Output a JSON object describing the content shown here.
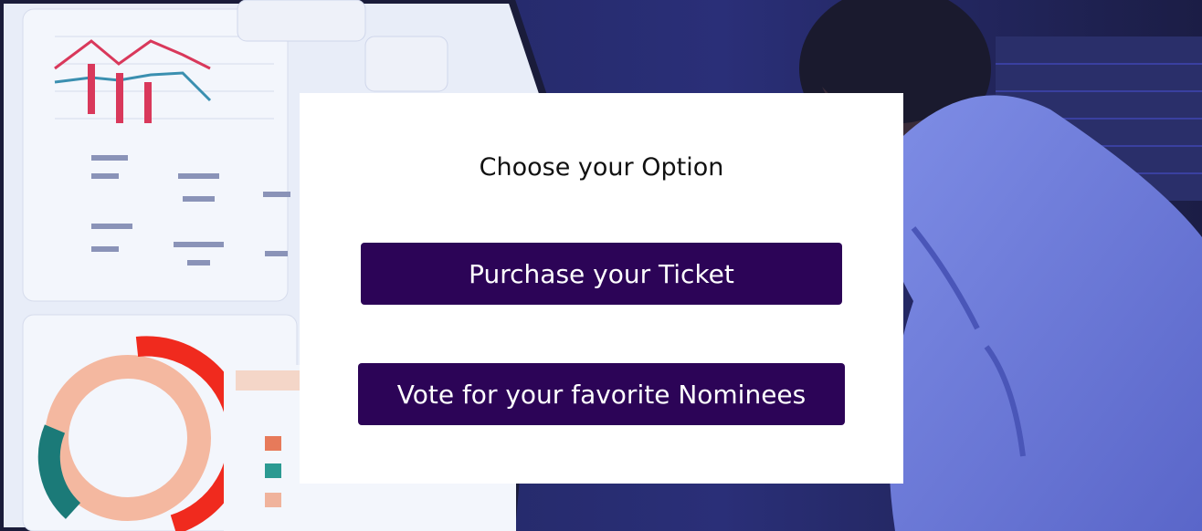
{
  "modal": {
    "title": "Choose your Option",
    "buttons": {
      "ticket_label": "Purchase your Ticket",
      "vote_label": "Vote for your favorite Nominees"
    }
  },
  "colors": {
    "button_bg": "#2c0457",
    "button_text": "#ffffff",
    "modal_bg": "#ffffff"
  }
}
